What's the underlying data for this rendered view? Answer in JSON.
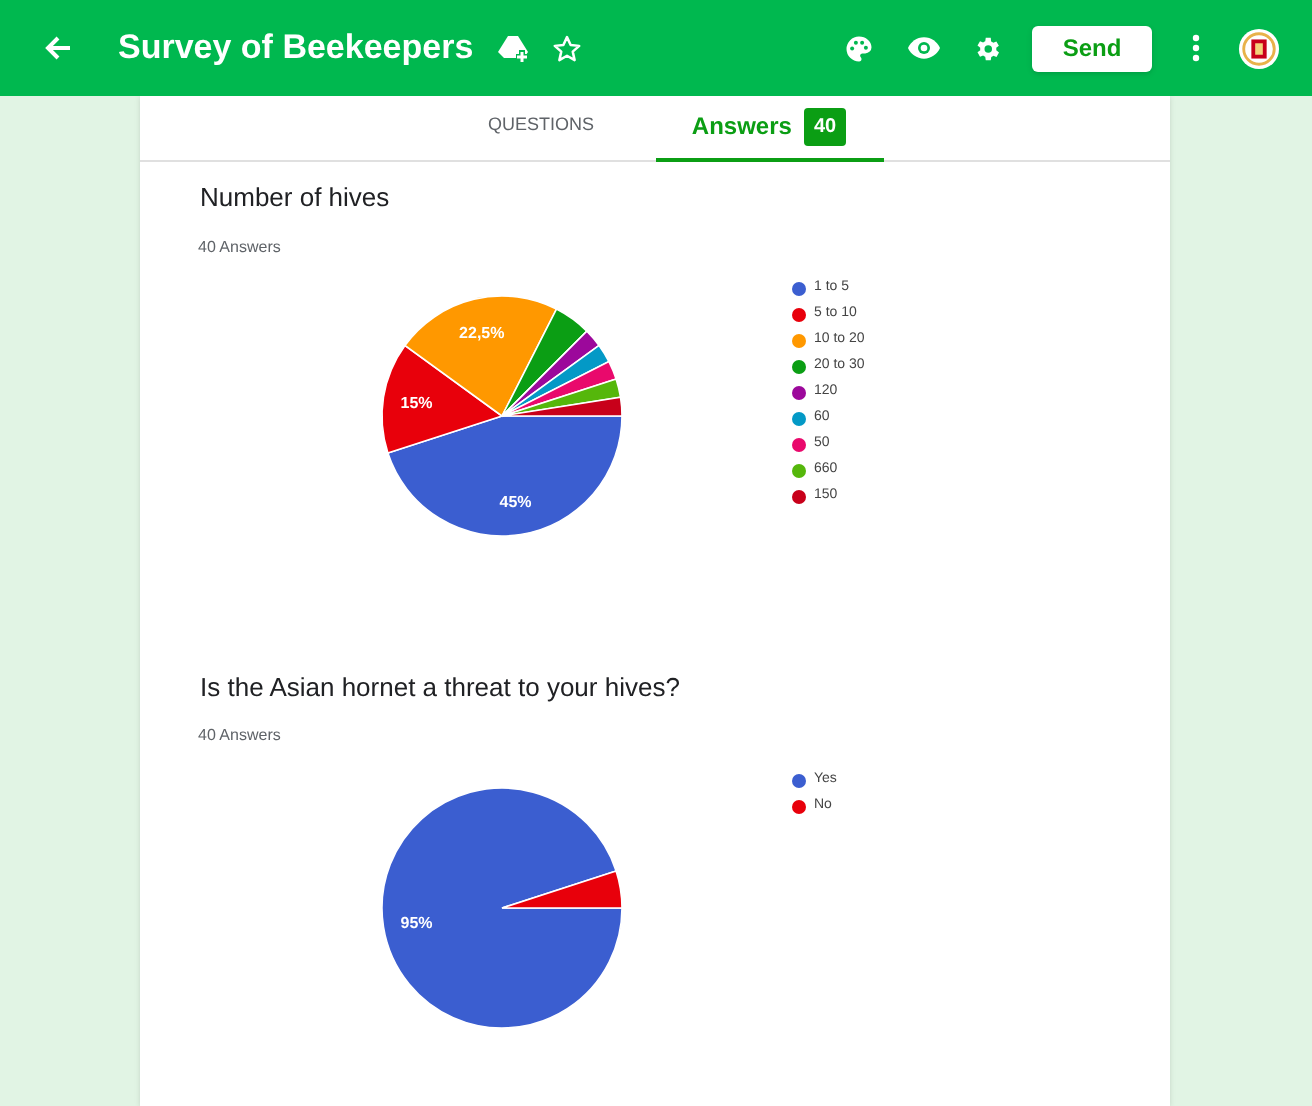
{
  "header": {
    "title": "Survey of Beekeepers",
    "send_button": "Send"
  },
  "tabs": [
    {
      "label": "QUESTIONS",
      "selected": false
    },
    {
      "label": "Answers",
      "badge": "40",
      "selected": true
    }
  ],
  "questions": [
    {
      "title": "Number of hives",
      "answer_count": "40 Answers",
      "chart_data": {
        "type": "pie",
        "categories": [
          "1 to 5",
          "5 to 10",
          "10 to 20",
          "20 to 30",
          "120",
          "60",
          "50",
          "660",
          "150"
        ],
        "series": [
          {
            "values": [
              45,
              15,
              22.5,
              5,
              2.5,
              2.5,
              2.5,
              2.5,
              2.5
            ]
          }
        ],
        "legend": "right",
        "colors": [
          "#3b5ed0",
          "#e8000b",
          "#ff9800",
          "#0b9e14",
          "#9c089b",
          "#0399c6",
          "#e9096c",
          "#55b70b",
          "#c8001a"
        ],
        "value_labels": [
          "45%",
          "15%",
          "22,5%",
          null,
          null,
          null,
          null,
          null,
          null
        ]
      }
    },
    {
      "title": "Is the Asian hornet a threat to your hives?",
      "answer_count": "40 Answers",
      "chart_data": {
        "type": "pie",
        "categories": [
          "Yes",
          "No"
        ],
        "series": [
          {
            "values": [
              95,
              5
            ]
          }
        ],
        "legend": "right",
        "colors": [
          "#3b5ed0",
          "#e8000b"
        ],
        "value_labels": [
          "95%",
          null
        ]
      }
    }
  ]
}
